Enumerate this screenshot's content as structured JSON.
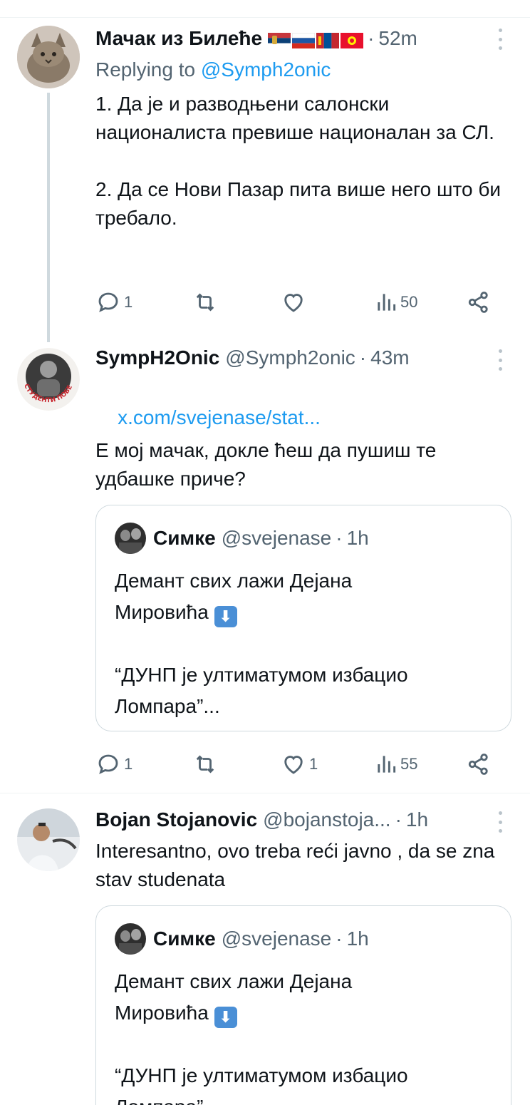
{
  "tweets": [
    {
      "name": "Мачак из Билеће",
      "time": "52m",
      "replying_prefix": "Replying to",
      "replying_to": "@Symph2onic",
      "text": "1. Да је и разводњени салонски националиста превише националан за СЛ.\n\n2. Да се Нови Пазар пита више него што би требало.",
      "replies": "1",
      "likes": "",
      "views": "50"
    },
    {
      "name": "SympH2Onic",
      "handle": "@Symph2onic",
      "time": "43m",
      "link": "x.com/svejenase/stat...",
      "text": "Е мој мачак, докле ћеш да пушиш те удбашке приче?",
      "quote": {
        "name": "Симке",
        "handle": "@svejenase",
        "time": "1h",
        "line1": "Демант свих лажи Дејана",
        "line2": "Мировића",
        "line3": "“ДУНП је ултиматумом избацио",
        "line4": "Ломпара”..."
      },
      "replies": "1",
      "likes": "1",
      "views": "55"
    },
    {
      "name": "Bojan Stojanovic",
      "handle": "@bojanstoja...",
      "time": "1h",
      "text": "Interesantno, ovo treba reći javno , da se zna stav studenata",
      "quote": {
        "name": "Симке",
        "handle": "@svejenase",
        "time": "1h",
        "line1": "Демант свих лажи Дејана",
        "line2": "Мировића",
        "line3": "“ДУНП је ултиматумом избацио",
        "line4": "Ломпара”"
      }
    }
  ],
  "avatar_text": "СТУДЕНТИ ПОБЕЂУЈУ",
  "colors": {
    "link": "#1d9bf0",
    "secondary": "#536471",
    "border": "#cfd9de"
  },
  "icons": [
    "reply-icon",
    "retweet-icon",
    "like-icon",
    "views-icon",
    "share-icon",
    "more-icon",
    "down-arrow-emoji"
  ]
}
